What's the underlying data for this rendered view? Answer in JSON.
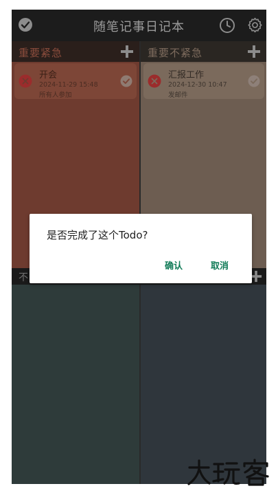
{
  "header": {
    "title": "随笔记事日记本",
    "check_icon": "check-circle-icon",
    "clock_icon": "clock-icon",
    "settings_icon": "gear-icon"
  },
  "quadrants": [
    {
      "title": "重要紧急",
      "add_icon": "plus-icon",
      "items": [
        {
          "title": "开会",
          "time": "2024-11-29 15:48",
          "note": "所有人参加"
        }
      ]
    },
    {
      "title": "重要不紧急",
      "add_icon": "plus-icon",
      "items": [
        {
          "title": "汇报工作",
          "time": "2024-12-30 10:47",
          "note": "发邮件"
        }
      ]
    }
  ],
  "hidden_band_label": "不",
  "dialog": {
    "message": "是否完成了这个Todo?",
    "confirm_label": "确认",
    "cancel_label": "取消"
  },
  "watermark": "大玩客",
  "colors": {
    "accent": "#0f7a56",
    "q1_bg": "#6e3b2f",
    "q2_bg": "#6d5d51",
    "q3_bg": "#2e3b3a",
    "q4_bg": "#2f363c"
  }
}
